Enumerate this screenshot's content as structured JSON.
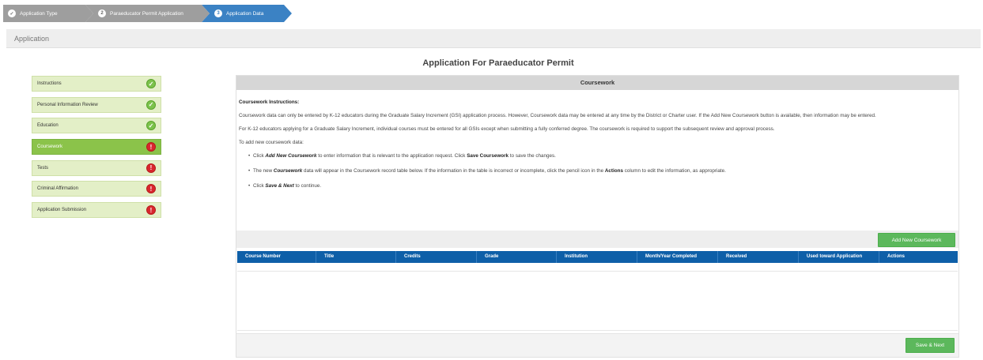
{
  "wizard": {
    "steps": [
      {
        "num": "✓",
        "label": "Application Type"
      },
      {
        "num": "2",
        "label": "Paraeducator Permit Application"
      },
      {
        "num": "3",
        "label": "Application Data"
      }
    ]
  },
  "header": {
    "title": "Application"
  },
  "page_title": "Application For Paraeducator Permit",
  "sidebar": {
    "items": [
      {
        "label": "Instructions",
        "status": "✓"
      },
      {
        "label": "Personal Information Review",
        "status": "✓"
      },
      {
        "label": "Education",
        "status": "✓"
      },
      {
        "label": "Coursework",
        "status": "!"
      },
      {
        "label": "Tests",
        "status": "!"
      },
      {
        "label": "Criminal Affirmation",
        "status": "!"
      },
      {
        "label": "Application Submission",
        "status": "!"
      }
    ]
  },
  "panel": {
    "title": "Coursework",
    "instructions_heading": "Coursework Instructions:",
    "para1": "Coursework data can only be entered by K-12 educators during the Graduate Salary Increment (GSI) application process. However, Coursework data may be entered at any time by the District or Charter user. If the Add New Coursework button is available, then information may be entered.",
    "para2": "For K-12 educators applying for a Graduate Salary Increment, individual courses must be entered for all GSIs except when submitting a fully conferred degree. The coursework is required to support the subsequent review and approval process.",
    "para3": "To add new coursework data:",
    "bullet1_pre": "Click ",
    "bullet1_b1": "Add New Coursework",
    "bullet1_mid": " to enter information that is relevant to the application request.  Click ",
    "bullet1_b2": "Save Coursework",
    "bullet1_post": " to save the changes.",
    "bullet2_pre": "The new ",
    "bullet2_b1": "Coursework",
    "bullet2_mid": " data will appear in the Coursework record table below. If the information in the table is incorrect or incomplete, click the pencil icon in the ",
    "bullet2_b2": "Actions",
    "bullet2_post": " column to edit the information, as appropriate.",
    "bullet3_pre": "Click ",
    "bullet3_b1": "Save & Next",
    "bullet3_post": " to continue.",
    "add_button": "Add New Coursework",
    "save_button": "Save & Next"
  },
  "table": {
    "columns": [
      "Course Number",
      "Title",
      "Credits",
      "Grade",
      "Institution",
      "Month/Year Completed",
      "Received",
      "Used toward Application",
      "Actions"
    ]
  },
  "colors": {
    "accent_blue": "#3b82c4",
    "table_header": "#0e5fa8",
    "button_green": "#5cb85c",
    "sidebar_active": "#8bc34a",
    "status_ok": "#7cc24c",
    "status_error": "#d9262f"
  }
}
